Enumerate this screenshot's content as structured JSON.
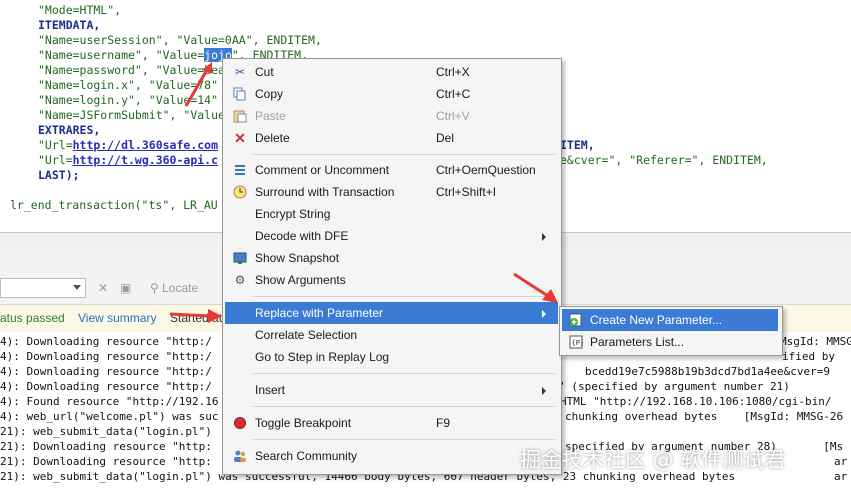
{
  "code_lines": [
    "\"Mode=HTML\",",
    "ITEMDATA,",
    "\"Name=userSession\", \"Value=0AA\", ENDITEM,",
    "\"Name=username\", \"Value=",
    "\"Name=password\", \"Value=bea",
    "\"Name=login.x\", \"Value=78\"",
    "\"Name=login.y\", \"Value=14\"",
    "\"Name=JSFormSubmit\", \"Value",
    "EXTRARES,",
    "\"Url=",
    "\"Url=",
    "LAST);",
    "lr_end_transaction(\"ts\", LR_AU"
  ],
  "code_fragments": {
    "selected_value": "jojo",
    "username_suffix": "\", ENDITEM,",
    "url1": "http://dl.360safe.com",
    "url1_tail": "ITEM,",
    "url2": "http://t.wg.360-api.c",
    "url2_tail": "e&cver=\", \"Referer=\", ENDITEM,"
  },
  "toolbar": {
    "locate_label": "Locate"
  },
  "status": {
    "passed": "atus passed",
    "view_summary": "View summary",
    "started": "Started at"
  },
  "log_lines": [
    "4): Downloading resource \"http:/",
    "4): Downloading resource \"http:/",
    "4): Downloading resource \"http:/",
    "4): Downloading resource \"http:/",
    "4): Found resource \"http://192.16",
    "4): web_url(\"welcome.pl\") was suc",
    "21): web_submit_data(\"login.pl\")",
    "21): Downloading resource \"http:",
    "21): Downloading resource \"http:",
    "21): web_submit_data(\"login.pl\") was successful, 14466 body bytes, 667 header bytes, 23 chunking overhead bytes"
  ],
  "log_right": [
    "MsgId: MMSG",
    "ified by",
    "bcedd19e7c5988b19b3dcd7bd1a4ee&cver=9",
    "s.dat\" (specified by argument number 21)",
    "HTML \"http://192.168.10.106:1080/cgi-bin/",
    "chunking overhead bytes    [MsgId: MMSG-26",
    "specified by argument number 28)       [Ms",
    "ar",
    "ar"
  ],
  "context_menu": {
    "items": [
      {
        "label": "Cut",
        "shortcut": "Ctrl+X"
      },
      {
        "label": "Copy",
        "shortcut": "Ctrl+C"
      },
      {
        "label": "Paste",
        "shortcut": "Ctrl+V"
      },
      {
        "label": "Delete",
        "shortcut": "Del"
      },
      {
        "label": "Comment or Uncomment",
        "shortcut": "Ctrl+OemQuestion"
      },
      {
        "label": "Surround with Transaction",
        "shortcut": "Ctrl+Shift+I"
      },
      {
        "label": "Encrypt String",
        "shortcut": ""
      },
      {
        "label": "Decode with DFE",
        "shortcut": ""
      },
      {
        "label": "Show Snapshot",
        "shortcut": ""
      },
      {
        "label": "Show Arguments",
        "shortcut": ""
      },
      {
        "label": "Replace with Parameter",
        "shortcut": ""
      },
      {
        "label": "Correlate Selection",
        "shortcut": ""
      },
      {
        "label": "Go to Step in Replay Log",
        "shortcut": ""
      },
      {
        "label": "Insert",
        "shortcut": ""
      },
      {
        "label": "Toggle Breakpoint",
        "shortcut": "F9"
      },
      {
        "label": "Search Community",
        "shortcut": ""
      }
    ]
  },
  "submenu": {
    "items": [
      {
        "label": "Create New Parameter..."
      },
      {
        "label": "Parameters List..."
      }
    ]
  },
  "watermark": "掘金技术社区 @ 软件测试君",
  "colors": {
    "highlight": "#3a7bd5",
    "arrow": "#e53935",
    "status_bg": "#fbf9e6"
  }
}
